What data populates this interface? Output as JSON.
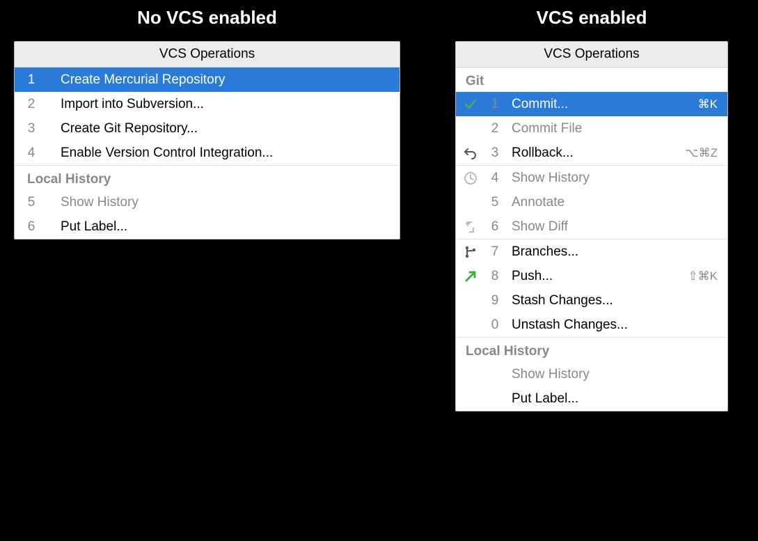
{
  "left": {
    "header": "No VCS enabled",
    "title": "VCS Operations",
    "items": [
      {
        "num": "1",
        "label": "Create Mercurial Repository",
        "selected": true
      },
      {
        "num": "2",
        "label": "Import into Subversion..."
      },
      {
        "num": "3",
        "label": "Create Git Repository..."
      },
      {
        "num": "4",
        "label": "Enable Version Control Integration..."
      }
    ],
    "section_header": "Local History",
    "history_items": [
      {
        "num": "5",
        "label": "Show History",
        "disabled": true
      },
      {
        "num": "6",
        "label": "Put Label..."
      }
    ]
  },
  "right": {
    "header": "VCS enabled",
    "title": "VCS Operations",
    "section_git": "Git",
    "git_items_a": [
      {
        "icon": "check",
        "num": "1",
        "label": "Commit...",
        "shortcut": "⌘K",
        "selected": true
      },
      {
        "icon": "",
        "num": "2",
        "label": "Commit File",
        "disabled": true
      },
      {
        "icon": "undo",
        "num": "3",
        "label": "Rollback...",
        "shortcut": "⌥⌘Z"
      }
    ],
    "git_items_b": [
      {
        "icon": "clock",
        "num": "4",
        "label": "Show History",
        "disabled": true
      },
      {
        "icon": "",
        "num": "5",
        "label": "Annotate",
        "disabled": true
      },
      {
        "icon": "diff",
        "num": "6",
        "label": "Show Diff",
        "disabled": true
      }
    ],
    "git_items_c": [
      {
        "icon": "branch",
        "num": "7",
        "label": "Branches..."
      },
      {
        "icon": "push",
        "num": "8",
        "label": "Push...",
        "shortcut": "⇧⌘K"
      },
      {
        "icon": "",
        "num": "9",
        "label": "Stash Changes..."
      },
      {
        "icon": "",
        "num": "0",
        "label": "Unstash Changes..."
      }
    ],
    "section_local": "Local History",
    "local_items": [
      {
        "icon": "",
        "num": "",
        "label": "Show History",
        "disabled": true
      },
      {
        "icon": "",
        "num": "",
        "label": "Put Label..."
      }
    ]
  }
}
